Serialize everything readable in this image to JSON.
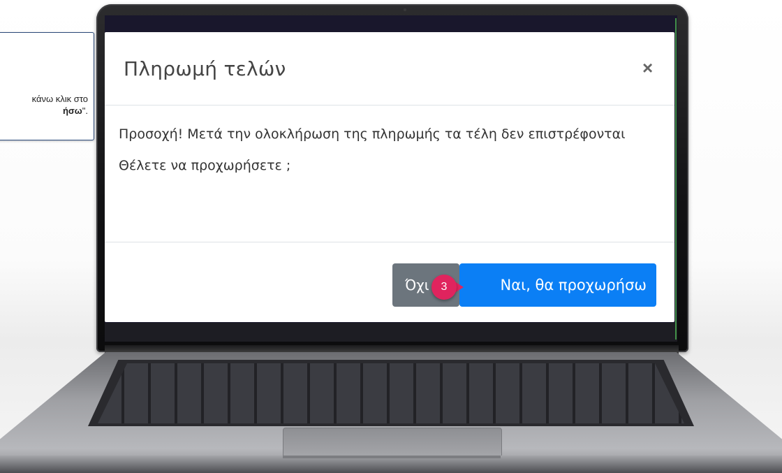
{
  "callout": {
    "line1": "κάνω κλικ στο",
    "line2_bold": "ήσω",
    "line2_tail": "\"."
  },
  "modal": {
    "title": "Πληρωμή τελών",
    "close_symbol": "×",
    "warning_text": "Προσοχή! Μετά την ολοκλήρωση της πληρωμής τα τέλη δεν επιστρέφονται",
    "question": "Θέλετε να προχωρήσετε ;",
    "no_button": "Όχι",
    "yes_button": "Ναι, θα προχωρήσω"
  },
  "step_marker": {
    "number": "3"
  },
  "colors": {
    "primary_button": "#0b7ff5",
    "secondary_button": "#6c757d",
    "step_marker": "#e0245e"
  }
}
